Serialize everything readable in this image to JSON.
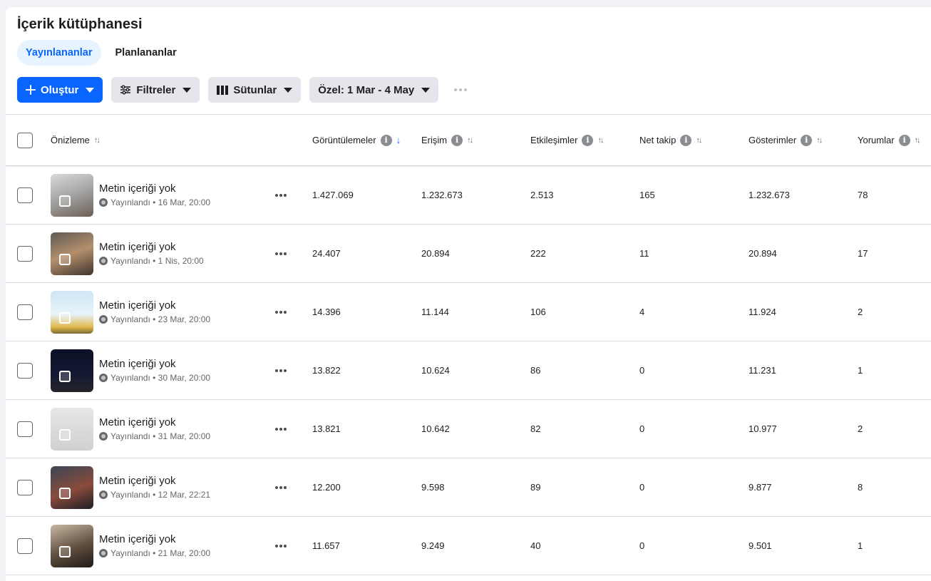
{
  "title": "İçerik kütüphanesi",
  "tabs": [
    {
      "label": "Yayınlananlar",
      "active": true
    },
    {
      "label": "Planlananlar",
      "active": false
    }
  ],
  "toolbar": {
    "create_label": "Oluştur",
    "filters_label": "Filtreler",
    "columns_label": "Sütunlar",
    "date_label": "Özel: 1 Mar - 4 May"
  },
  "columns": {
    "preview": "Önizleme",
    "views": "Görüntülemeler",
    "reach": "Erişim",
    "engagement": "Etkileşimler",
    "net_follow": "Net takip",
    "impressions": "Gösterimler",
    "comments": "Yorumlar"
  },
  "rows": [
    {
      "title": "Metin içeriği yok",
      "meta": "Yayınlandı • 16 Mar, 20:00",
      "views": "1.427.069",
      "reach": "1.232.673",
      "engagement": "2.513",
      "net_follow": "165",
      "impressions": "1.232.673",
      "comments": "78"
    },
    {
      "title": "Metin içeriği yok",
      "meta": "Yayınlandı • 1 Nis, 20:00",
      "views": "24.407",
      "reach": "20.894",
      "engagement": "222",
      "net_follow": "11",
      "impressions": "20.894",
      "comments": "17"
    },
    {
      "title": "Metin içeriği yok",
      "meta": "Yayınlandı • 23 Mar, 20:00",
      "views": "14.396",
      "reach": "11.144",
      "engagement": "106",
      "net_follow": "4",
      "impressions": "11.924",
      "comments": "2"
    },
    {
      "title": "Metin içeriği yok",
      "meta": "Yayınlandı • 30 Mar, 20:00",
      "views": "13.822",
      "reach": "10.624",
      "engagement": "86",
      "net_follow": "0",
      "impressions": "11.231",
      "comments": "1"
    },
    {
      "title": "Metin içeriği yok",
      "meta": "Yayınlandı • 31 Mar, 20:00",
      "views": "13.821",
      "reach": "10.642",
      "engagement": "82",
      "net_follow": "0",
      "impressions": "10.977",
      "comments": "2"
    },
    {
      "title": "Metin içeriği yok",
      "meta": "Yayınlandı • 12 Mar, 22:21",
      "views": "12.200",
      "reach": "9.598",
      "engagement": "89",
      "net_follow": "0",
      "impressions": "9.877",
      "comments": "8"
    },
    {
      "title": "Metin içeriği yok",
      "meta": "Yayınlandı • 21 Mar, 20:00",
      "views": "11.657",
      "reach": "9.249",
      "engagement": "40",
      "net_follow": "0",
      "impressions": "9.501",
      "comments": "1"
    }
  ],
  "colors": {
    "accent": "#0866ff",
    "tab_active_bg": "#e7f3ff",
    "button_bg": "#e4e6eb"
  }
}
